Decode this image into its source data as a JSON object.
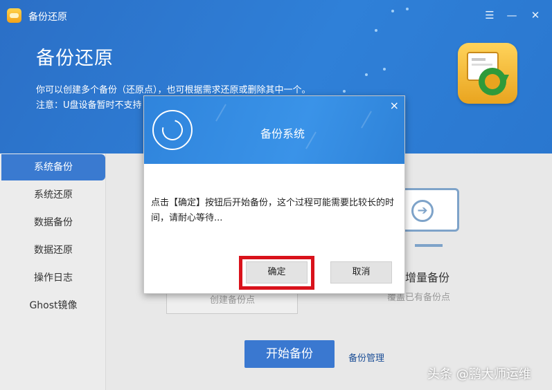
{
  "window": {
    "title": "备份还原",
    "controls": [
      "menu-icon",
      "minimize-icon",
      "close-icon"
    ]
  },
  "header": {
    "title": "备份还原",
    "description": "你可以创建多个备份（还原点），也可根据需求还原或删除其中一个。",
    "note": "注意：U盘设备暂时不支持"
  },
  "sidebar": {
    "items": [
      {
        "label": "系统备份",
        "active": true
      },
      {
        "label": "系统还原",
        "active": false
      },
      {
        "label": "数据备份",
        "active": false
      },
      {
        "label": "数据还原",
        "active": false
      },
      {
        "label": "操作日志",
        "active": false
      },
      {
        "label": "Ghost镜像",
        "active": false
      }
    ]
  },
  "main": {
    "card_left_sub": "创建备份点",
    "card_right_title": "统增量备份",
    "card_right_sub": "覆盖已有备份点",
    "start_button": "开始备份",
    "manage_link": "备份管理"
  },
  "dialog": {
    "title": "备份系统",
    "message": "点击【确定】按钮后开始备份，这个过程可能需要比较长的时间，请耐心等待...",
    "ok_label": "确定",
    "cancel_label": "取消",
    "close_glyph": "×"
  },
  "watermark": "头条 @鹏大师运维",
  "colors": {
    "header_blue": "#2f80d8",
    "active_sidebar": "#3a7ad0",
    "highlight_red": "#d9121b"
  }
}
